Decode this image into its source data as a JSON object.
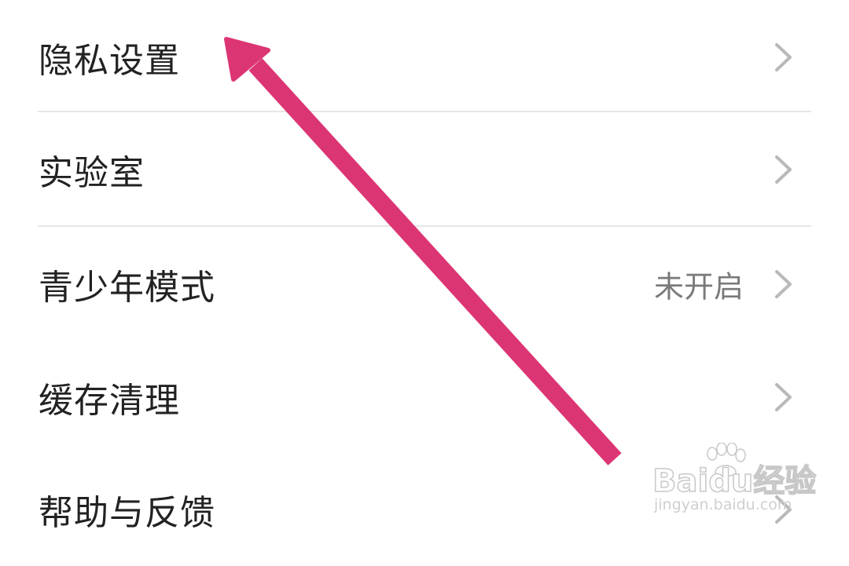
{
  "settings": {
    "items": [
      {
        "label": "隐私设置",
        "value": ""
      },
      {
        "label": "实验室",
        "value": ""
      },
      {
        "label": "青少年模式",
        "value": "未开启"
      },
      {
        "label": "缓存清理",
        "value": ""
      },
      {
        "label": "帮助与反馈",
        "value": ""
      }
    ]
  },
  "watermark": {
    "brand": "Baidu经验",
    "url": "jingyan.baidu.com"
  },
  "colors": {
    "background": "#ffffff",
    "label_text": "#222222",
    "value_text": "#7a7a7a",
    "chevron": "#b9b9b9",
    "divider": "#e6e6e6",
    "annotation_arrow": "#dc3574"
  },
  "icons": {
    "row_chevron": "chevron-right-icon",
    "annotation": "pointer-arrow-icon"
  }
}
